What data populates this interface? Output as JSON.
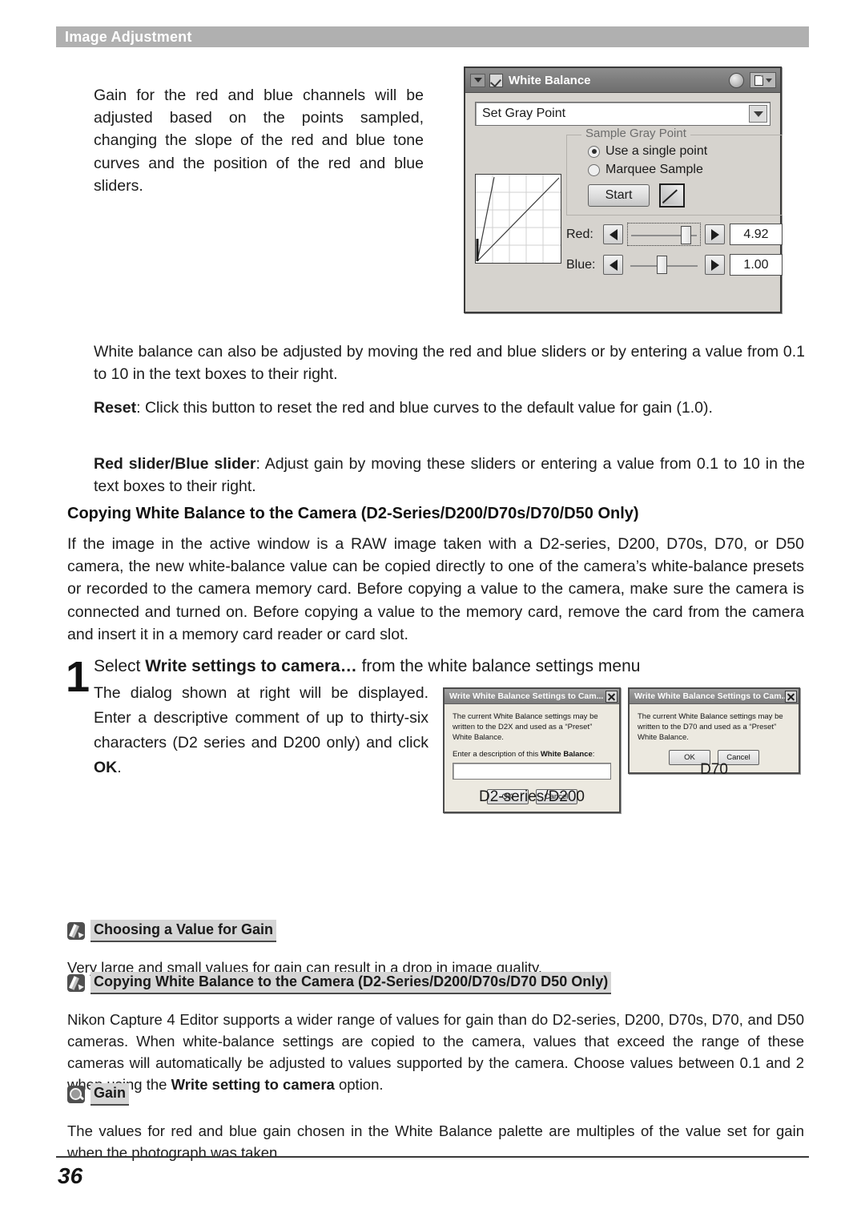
{
  "header": {
    "title": "Image Adjustment"
  },
  "intro": {
    "text": "Gain for the red and blue channels will be adjusted based on the points sampled, changing the slope of the red and blue tone curves and the position of the red and blue sliders."
  },
  "white_balance_palette": {
    "title": "White Balance",
    "checkbox_checked": true,
    "collapse_icon": "triangle-down-icon",
    "orb_icon": "status-orb-icon",
    "menu_icon": "page-menu-icon",
    "mode_select": {
      "value": "Set Gray Point",
      "options": [
        "Set Gray Point"
      ]
    },
    "sample_group": {
      "legend": "Sample Gray Point",
      "radios": [
        {
          "label": "Use a single point",
          "selected": true
        },
        {
          "label": "Marquee Sample",
          "selected": false
        }
      ],
      "start_button": "Start",
      "curve_button_icon": "tone-curve-icon"
    },
    "sliders": [
      {
        "label": "Red:",
        "value": "4.92",
        "knob_percent": 78,
        "focused": true
      },
      {
        "label": "Blue:",
        "value": "1.00",
        "knob_percent": 44,
        "focused": false
      }
    ],
    "curve_preview_icon": "tone-curve-graph"
  },
  "paragraphs": {
    "wb_also": "White balance can also be adjusted by moving the red and blue sliders or by entering a value from 0.1 to 10 in the text boxes to their right.",
    "reset_term": "Reset",
    "reset_rest": ": Click this button to reset the red and blue curves to the default value for gain (1.0).",
    "slider_term": "Red slider/Blue slider",
    "slider_rest": ": Adjust gain by moving these sliders or entering a value from 0.1 to 10 in the text boxes to their right."
  },
  "copying_section": {
    "heading": "Copying White Balance to the Camera (D2-Series/D200/D70s/D70/D50 Only)",
    "body": "If the image in the active window is a RAW image taken with a D2-series, D200, D70s, D70, or D50 camera, the new white-balance value can be copied directly to one of the camera’s white-balance presets or recorded to the camera memory card.  Before copying a value to the camera, make sure the camera is connected and turned on.  Before copying a value to the memory card, remove the card from the camera and insert it in a memory card reader or card slot."
  },
  "step": {
    "number": "1",
    "title_pre": "Select ",
    "title_bold": "Write settings to camera…",
    "title_post": " from the white balance settings menu",
    "body_pre": "The dialog shown at right will be displayed.  Enter a descriptive comment of up to thirty-six characters (D2 series and D200 only) and click ",
    "body_bold": "OK",
    "body_post": "."
  },
  "dialogs": [
    {
      "id": "d2",
      "title": "Write White Balance Settings to Cam...",
      "close_icon": "close-icon",
      "message_pre": "The current White Balance settings may be written to the D2X and used as a “Preset” White Balance.",
      "field_label_pre": "Enter a description of this ",
      "field_label_bold": "White Balance",
      "field_label_post": ":",
      "input_value": "",
      "buttons": [
        "OK",
        "Cancel"
      ],
      "caption": "D2-series/D200"
    },
    {
      "id": "d70",
      "title": "Write White Balance Settings to Cam...",
      "close_icon": "close-icon",
      "message_pre": "The current White Balance settings may be written to the D70 and used as a “Preset” White Balance.",
      "buttons": [
        "OK",
        "Cancel"
      ],
      "caption": "D70"
    }
  ],
  "notes": [
    {
      "icon": "pencil-note-icon",
      "title": "Choosing a Value for Gain",
      "body": "Very large and small values for gain can result in a drop in image quality."
    },
    {
      "icon": "pencil-note-icon",
      "title": "Copying White Balance to the Camera (D2-Series/D200/D70s/D70 D50 Only)",
      "body_pre": "Nikon Capture 4 Editor supports a wider range of values for gain than do D2-series, D200, D70s, D70, and D50 cameras.  When white-balance settings are copied to the camera, values that exceed the range of these cameras will automatically be adjusted to values supported by the camera.  Choose values between 0.1 and 2 when using the ",
      "body_bold": "Write setting to camera",
      "body_post": " option."
    },
    {
      "icon": "magnifier-note-icon",
      "title": "Gain",
      "body": "The values for red and blue gain chosen in the White Balance palette are multiples of the value set for gain when the photograph was taken."
    }
  ],
  "footer": {
    "page_number": "36"
  }
}
